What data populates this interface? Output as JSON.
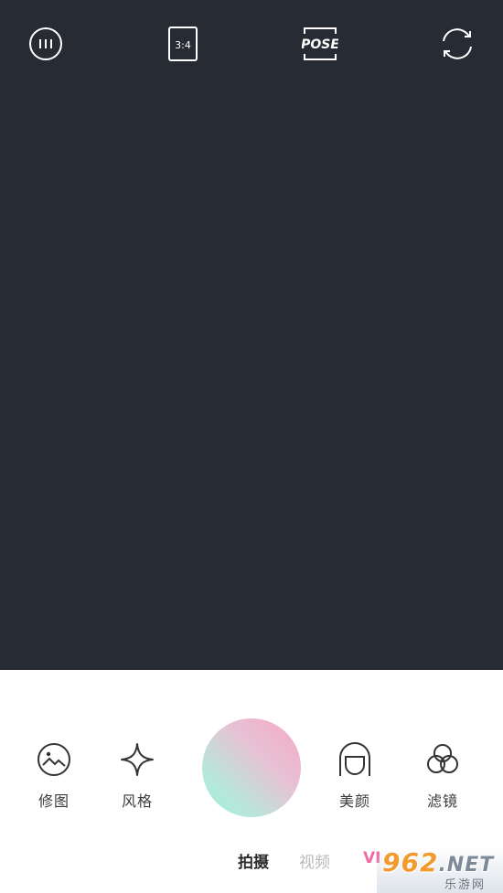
{
  "top_bar": {
    "items": [
      {
        "name": "menu-icon"
      },
      {
        "name": "aspect-ratio-icon",
        "label": "3:4"
      },
      {
        "name": "pose-icon",
        "label": "POSE"
      },
      {
        "name": "switch-camera-icon"
      }
    ]
  },
  "tools": {
    "edit": "修图",
    "style": "风格",
    "beauty": "美颜",
    "filter": "滤镜"
  },
  "modes": {
    "photo": "拍摄",
    "video": "视频",
    "vip": "VI"
  },
  "watermark": {
    "brand": "962",
    "suffix": ".NET",
    "subtitle": "乐游网"
  },
  "colors": {
    "viewfinder": "#272b33",
    "shutter_pink": "#f7a7c6",
    "shutter_mint": "#9ff0dc",
    "mode_pink": "#f16aa5"
  }
}
